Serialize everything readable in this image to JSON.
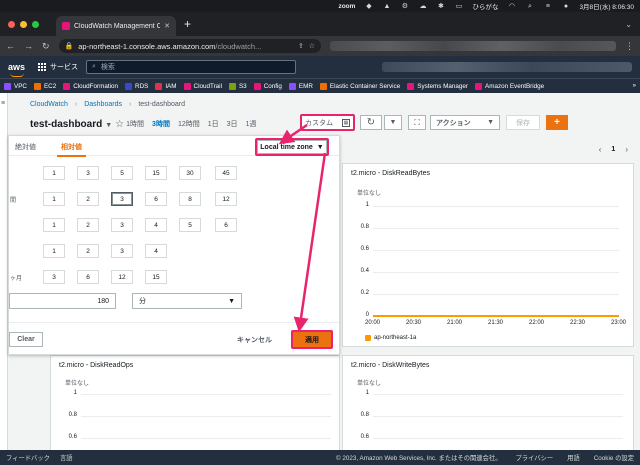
{
  "macbar": {
    "zoom": "zoom",
    "ime": "ひらがな",
    "datetime": "3月8日(水) 8:06:30"
  },
  "browser": {
    "tab_title": "CloudWatch Management Cons",
    "url_host": "ap-northeast-1.console.aws.amazon.com",
    "url_path": "/cloudwatch..."
  },
  "aws": {
    "logo": "aws",
    "services_label": "サービス",
    "search_placeholder": "検索",
    "favorites": [
      {
        "label": "VPC",
        "color": "#8c4fff"
      },
      {
        "label": "EC2",
        "color": "#ed7100"
      },
      {
        "label": "CloudFormation",
        "color": "#e7157b"
      },
      {
        "label": "RDS",
        "color": "#3b48cc"
      },
      {
        "label": "IAM",
        "color": "#dd344c"
      },
      {
        "label": "CloudTrail",
        "color": "#e7157b"
      },
      {
        "label": "S3",
        "color": "#7aa116"
      },
      {
        "label": "Config",
        "color": "#e7157b"
      },
      {
        "label": "EMR",
        "color": "#8c4fff"
      },
      {
        "label": "Elastic Container Service",
        "color": "#ed7100"
      },
      {
        "label": "Systems Manager",
        "color": "#e7157b"
      },
      {
        "label": "Amazon EventBridge",
        "color": "#e7157b"
      }
    ]
  },
  "breadcrumb": {
    "root": "CloudWatch",
    "dashboards": "Dashboards",
    "current": "test-dashboard"
  },
  "dashboard": {
    "title": "test-dashboard",
    "ranges": [
      "1時間",
      "3時間",
      "12時間",
      "1日",
      "3日",
      "1週"
    ],
    "active_range": "3時間",
    "custom_label": "カスタム",
    "action_label": "アクション",
    "save_label": "保存",
    "add_label": "+"
  },
  "popover": {
    "tab_absolute": "絶対値",
    "tab_relative": "相対値",
    "timezone": "Local time zone",
    "rows": [
      {
        "values": [
          "1",
          "3",
          "5",
          "15",
          "30",
          "45"
        ]
      },
      {
        "label": "間",
        "values": [
          "1",
          "2",
          "3",
          "6",
          "8",
          "12"
        ],
        "selected": "3"
      },
      {
        "values": [
          "1",
          "2",
          "3",
          "4",
          "5",
          "6"
        ]
      },
      {
        "values": [
          "1",
          "2",
          "3",
          "4"
        ]
      },
      {
        "label": "ヶ月",
        "values": [
          "3",
          "6",
          "12",
          "15"
        ]
      }
    ],
    "input_value": "180",
    "unit_value": "分",
    "clear_label": "Clear",
    "cancel_label": "キャンセル",
    "apply_label": "適用"
  },
  "pager": {
    "page": "1"
  },
  "widgets": {
    "disk_read_bytes": {
      "title": "t2.micro - DiskReadBytes",
      "unit": "単位なし",
      "yticks": [
        "1",
        "0.8",
        "0.6",
        "0.4",
        "0.2",
        "0"
      ],
      "xticks": [
        "20:00",
        "20:30",
        "21:00",
        "21:30",
        "22:00",
        "22:30",
        "23:00"
      ],
      "legend": "ap-northeast-1a",
      "series_color": "#ff9900"
    },
    "disk_read_ops": {
      "title": "t2.micro - DiskReadOps",
      "unit": "単位なし",
      "yticks": [
        "1",
        "0.8",
        "0.6"
      ]
    },
    "disk_write_bytes": {
      "title": "t2.micro - DiskWriteBytes",
      "unit": "単位なし",
      "yticks": [
        "1",
        "0.8",
        "0.6"
      ]
    }
  },
  "footer": {
    "feedback": "フィードバック",
    "language": "言語",
    "copyright": "© 2023, Amazon Web Services, Inc. またはその関連会社。",
    "privacy": "プライバシー",
    "terms": "用語",
    "cookie": "Cookie の設定"
  }
}
